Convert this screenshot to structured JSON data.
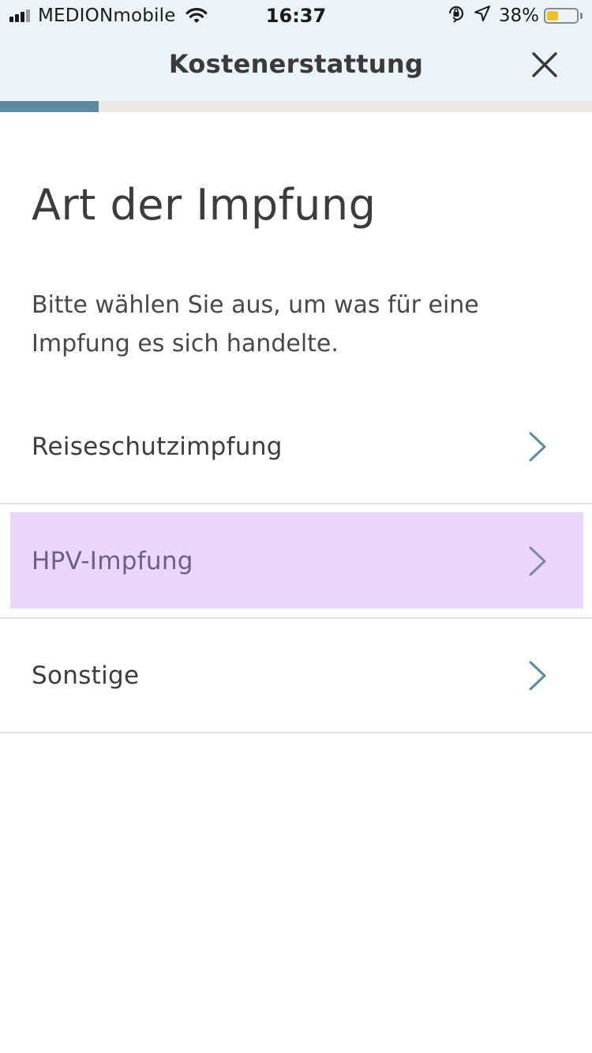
{
  "status_bar": {
    "carrier": "MEDIONmobile",
    "time": "16:37",
    "battery_percent": "38%",
    "battery_level": 0.38,
    "signal_bars_active": 3,
    "signal_bars_total": 4
  },
  "nav": {
    "title": "Kostenerstattung",
    "close_icon": "close-icon"
  },
  "progress": {
    "value": 0.166
  },
  "page": {
    "heading": "Art der Impfung",
    "description": "Bitte wählen Sie aus, um was für eine Impfung es sich handelte."
  },
  "options": [
    {
      "label": "Reiseschutzimpfung",
      "icon": "chevron-right-icon",
      "highlighted": false
    },
    {
      "label": "HPV-Impfung",
      "icon": "chevron-right-icon",
      "highlighted": true
    },
    {
      "label": "Sonstige",
      "icon": "chevron-right-icon",
      "highlighted": false
    }
  ],
  "colors": {
    "accent": "#5d8aa0",
    "header_bg": "#ecf3f6",
    "highlight": "#ead6fa",
    "battery": "#f0c22a"
  }
}
